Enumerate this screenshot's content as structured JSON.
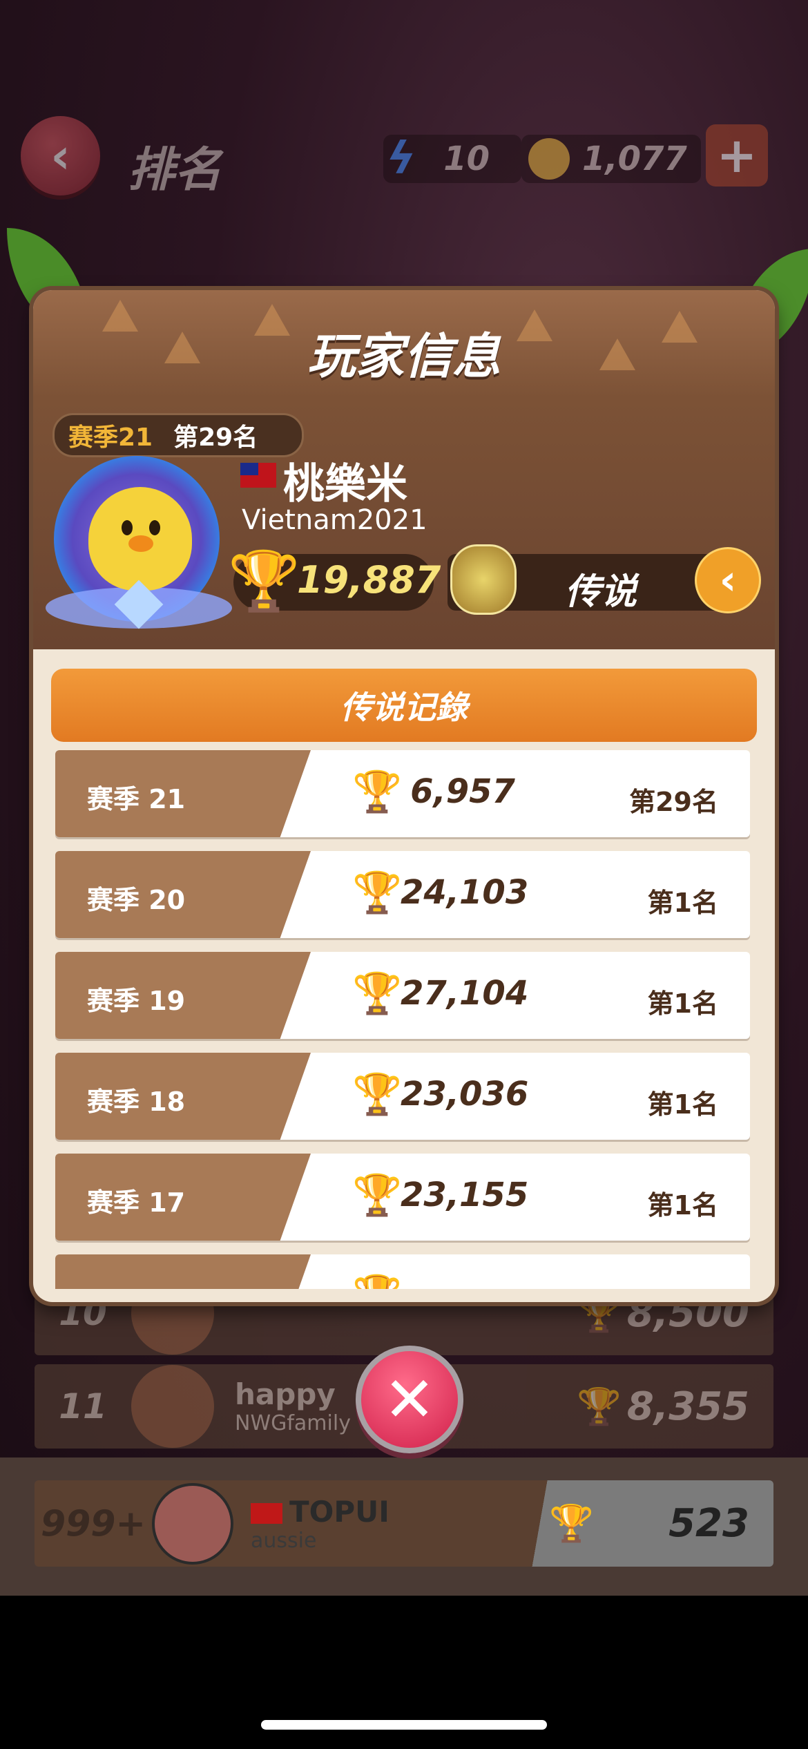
{
  "header": {
    "title": "排名",
    "back_icon": "chevron-left-icon",
    "energy": "10",
    "coins": "1,077",
    "plus_label": "+"
  },
  "background_rows": [
    {
      "rank": "10",
      "name": "",
      "subname": "",
      "score": "8,500"
    },
    {
      "rank": "11",
      "name": "happy",
      "subname": "NWGfamily",
      "score": "8,355"
    }
  ],
  "self_row": {
    "rank": "999+",
    "name": "TOPUI",
    "subname": "aussie",
    "score": "523"
  },
  "modal": {
    "title": "玩家信息",
    "season_badge": {
      "season": "赛季21",
      "rank": "第29名"
    },
    "player": {
      "name": "桃樂米",
      "id": "Vietnam2021",
      "trophies": "19,887"
    },
    "league": {
      "name": "传说",
      "button_icon": "chevron-left-icon"
    },
    "section_title": "传说记錄",
    "records": [
      {
        "season": "赛季 21",
        "trophies": "6,957",
        "rank": "第29名"
      },
      {
        "season": "赛季 20",
        "trophies": "24,103",
        "rank": "第1名"
      },
      {
        "season": "赛季 19",
        "trophies": "27,104",
        "rank": "第1名"
      },
      {
        "season": "赛季 18",
        "trophies": "23,036",
        "rank": "第1名"
      },
      {
        "season": "赛季 17",
        "trophies": "23,155",
        "rank": "第1名"
      },
      {
        "season": "",
        "trophies": "",
        "rank": ""
      }
    ],
    "close_icon": "close-icon"
  },
  "colors": {
    "accent": "#e27a22",
    "brown": "#a87a56",
    "trophy": "#e0a820",
    "close": "#d0204a"
  }
}
